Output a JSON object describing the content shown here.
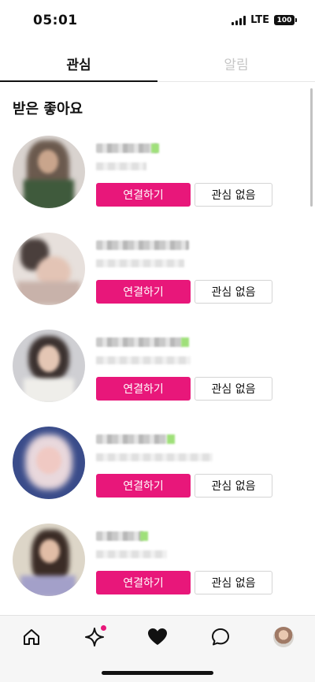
{
  "status_bar": {
    "time": "05:01",
    "network": "LTE",
    "battery": "100"
  },
  "tabs": [
    {
      "label": "관심",
      "active": true
    },
    {
      "label": "알림",
      "active": false
    }
  ],
  "section_title": "받은 좋아요",
  "items": [
    {
      "connect_label": "연결하기",
      "pass_label": "관심 없음"
    },
    {
      "connect_label": "연결하기",
      "pass_label": "관심 없음"
    },
    {
      "connect_label": "연결하기",
      "pass_label": "관심 없음"
    },
    {
      "connect_label": "연결하기",
      "pass_label": "관심 없음"
    },
    {
      "connect_label": "연결하기",
      "pass_label": "관심 없음"
    }
  ],
  "bottom_nav": [
    {
      "icon": "home-icon"
    },
    {
      "icon": "sparkle-icon",
      "badge_color": "#e8177a"
    },
    {
      "icon": "heart-icon",
      "active": true
    },
    {
      "icon": "chat-bubble-icon"
    },
    {
      "icon": "profile-avatar"
    }
  ],
  "colors": {
    "accent": "#e8177a",
    "name_highlight": "#9fe07a"
  }
}
